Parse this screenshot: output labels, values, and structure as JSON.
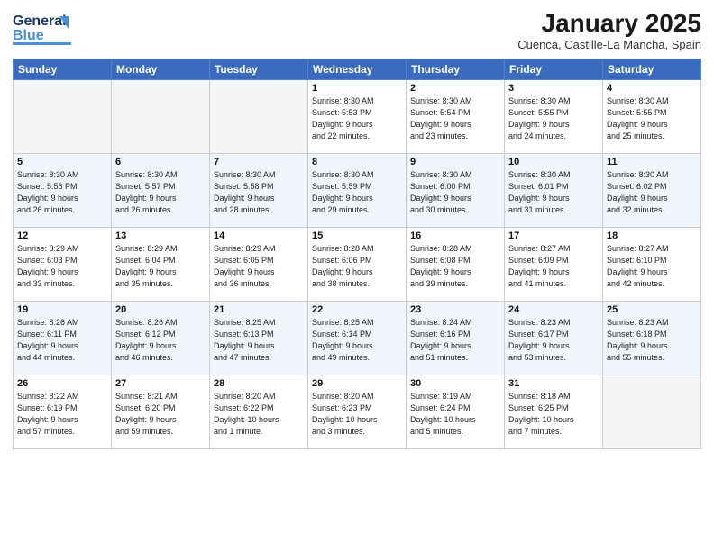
{
  "header": {
    "logo_line1": "General",
    "logo_line2": "Blue",
    "month_year": "January 2025",
    "location": "Cuenca, Castille-La Mancha, Spain"
  },
  "days_of_week": [
    "Sunday",
    "Monday",
    "Tuesday",
    "Wednesday",
    "Thursday",
    "Friday",
    "Saturday"
  ],
  "weeks": [
    [
      {
        "num": "",
        "detail": ""
      },
      {
        "num": "",
        "detail": ""
      },
      {
        "num": "",
        "detail": ""
      },
      {
        "num": "1",
        "detail": "Sunrise: 8:30 AM\nSunset: 5:53 PM\nDaylight: 9 hours\nand 22 minutes."
      },
      {
        "num": "2",
        "detail": "Sunrise: 8:30 AM\nSunset: 5:54 PM\nDaylight: 9 hours\nand 23 minutes."
      },
      {
        "num": "3",
        "detail": "Sunrise: 8:30 AM\nSunset: 5:55 PM\nDaylight: 9 hours\nand 24 minutes."
      },
      {
        "num": "4",
        "detail": "Sunrise: 8:30 AM\nSunset: 5:55 PM\nDaylight: 9 hours\nand 25 minutes."
      }
    ],
    [
      {
        "num": "5",
        "detail": "Sunrise: 8:30 AM\nSunset: 5:56 PM\nDaylight: 9 hours\nand 26 minutes."
      },
      {
        "num": "6",
        "detail": "Sunrise: 8:30 AM\nSunset: 5:57 PM\nDaylight: 9 hours\nand 26 minutes."
      },
      {
        "num": "7",
        "detail": "Sunrise: 8:30 AM\nSunset: 5:58 PM\nDaylight: 9 hours\nand 28 minutes."
      },
      {
        "num": "8",
        "detail": "Sunrise: 8:30 AM\nSunset: 5:59 PM\nDaylight: 9 hours\nand 29 minutes."
      },
      {
        "num": "9",
        "detail": "Sunrise: 8:30 AM\nSunset: 6:00 PM\nDaylight: 9 hours\nand 30 minutes."
      },
      {
        "num": "10",
        "detail": "Sunrise: 8:30 AM\nSunset: 6:01 PM\nDaylight: 9 hours\nand 31 minutes."
      },
      {
        "num": "11",
        "detail": "Sunrise: 8:30 AM\nSunset: 6:02 PM\nDaylight: 9 hours\nand 32 minutes."
      }
    ],
    [
      {
        "num": "12",
        "detail": "Sunrise: 8:29 AM\nSunset: 6:03 PM\nDaylight: 9 hours\nand 33 minutes."
      },
      {
        "num": "13",
        "detail": "Sunrise: 8:29 AM\nSunset: 6:04 PM\nDaylight: 9 hours\nand 35 minutes."
      },
      {
        "num": "14",
        "detail": "Sunrise: 8:29 AM\nSunset: 6:05 PM\nDaylight: 9 hours\nand 36 minutes."
      },
      {
        "num": "15",
        "detail": "Sunrise: 8:28 AM\nSunset: 6:06 PM\nDaylight: 9 hours\nand 38 minutes."
      },
      {
        "num": "16",
        "detail": "Sunrise: 8:28 AM\nSunset: 6:08 PM\nDaylight: 9 hours\nand 39 minutes."
      },
      {
        "num": "17",
        "detail": "Sunrise: 8:27 AM\nSunset: 6:09 PM\nDaylight: 9 hours\nand 41 minutes."
      },
      {
        "num": "18",
        "detail": "Sunrise: 8:27 AM\nSunset: 6:10 PM\nDaylight: 9 hours\nand 42 minutes."
      }
    ],
    [
      {
        "num": "19",
        "detail": "Sunrise: 8:26 AM\nSunset: 6:11 PM\nDaylight: 9 hours\nand 44 minutes."
      },
      {
        "num": "20",
        "detail": "Sunrise: 8:26 AM\nSunset: 6:12 PM\nDaylight: 9 hours\nand 46 minutes."
      },
      {
        "num": "21",
        "detail": "Sunrise: 8:25 AM\nSunset: 6:13 PM\nDaylight: 9 hours\nand 47 minutes."
      },
      {
        "num": "22",
        "detail": "Sunrise: 8:25 AM\nSunset: 6:14 PM\nDaylight: 9 hours\nand 49 minutes."
      },
      {
        "num": "23",
        "detail": "Sunrise: 8:24 AM\nSunset: 6:16 PM\nDaylight: 9 hours\nand 51 minutes."
      },
      {
        "num": "24",
        "detail": "Sunrise: 8:23 AM\nSunset: 6:17 PM\nDaylight: 9 hours\nand 53 minutes."
      },
      {
        "num": "25",
        "detail": "Sunrise: 8:23 AM\nSunset: 6:18 PM\nDaylight: 9 hours\nand 55 minutes."
      }
    ],
    [
      {
        "num": "26",
        "detail": "Sunrise: 8:22 AM\nSunset: 6:19 PM\nDaylight: 9 hours\nand 57 minutes."
      },
      {
        "num": "27",
        "detail": "Sunrise: 8:21 AM\nSunset: 6:20 PM\nDaylight: 9 hours\nand 59 minutes."
      },
      {
        "num": "28",
        "detail": "Sunrise: 8:20 AM\nSunset: 6:22 PM\nDaylight: 10 hours\nand 1 minute."
      },
      {
        "num": "29",
        "detail": "Sunrise: 8:20 AM\nSunset: 6:23 PM\nDaylight: 10 hours\nand 3 minutes."
      },
      {
        "num": "30",
        "detail": "Sunrise: 8:19 AM\nSunset: 6:24 PM\nDaylight: 10 hours\nand 5 minutes."
      },
      {
        "num": "31",
        "detail": "Sunrise: 8:18 AM\nSunset: 6:25 PM\nDaylight: 10 hours\nand 7 minutes."
      },
      {
        "num": "",
        "detail": ""
      }
    ]
  ]
}
